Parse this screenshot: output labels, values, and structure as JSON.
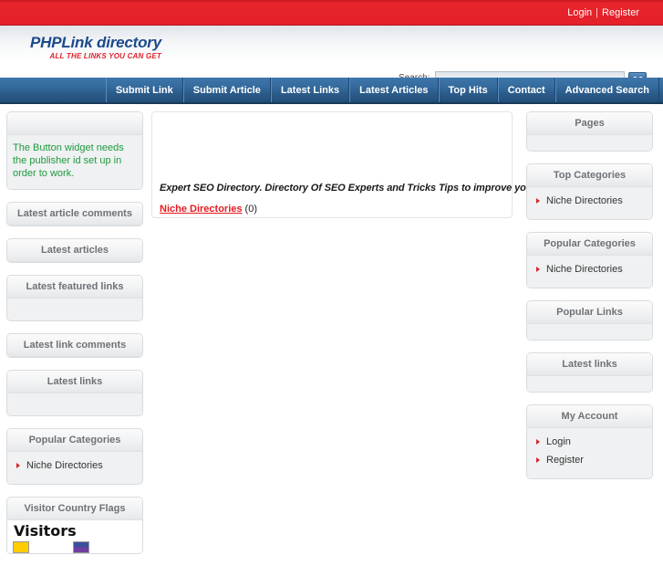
{
  "topbar": {
    "login": "Login",
    "separator": "|",
    "register": "Register"
  },
  "header": {
    "logo_text": "PHPLink directory",
    "logo_tagline": "ALL THE LINKS YOU CAN GET",
    "search_label": "Search:",
    "search_value": "",
    "search_placeholder": "",
    "go_label": "GO"
  },
  "nav": {
    "items": [
      {
        "label": "Submit Link"
      },
      {
        "label": "Submit Article"
      },
      {
        "label": "Latest Links"
      },
      {
        "label": "Latest Articles"
      },
      {
        "label": "Top Hits"
      },
      {
        "label": "Contact"
      },
      {
        "label": "Advanced Search"
      }
    ]
  },
  "left_sidebar": {
    "widgets": [
      {
        "title": "",
        "note": "The Button widget needs the publisher id set up in order to work."
      },
      {
        "title": "Latest article comments"
      },
      {
        "title": "Latest articles"
      },
      {
        "title": "Latest featured links"
      },
      {
        "title": "Latest link comments"
      },
      {
        "title": "Latest links"
      },
      {
        "title": "Popular Categories",
        "links": [
          {
            "label": "Niche Directories"
          }
        ]
      },
      {
        "title": "Visitor Country Flags",
        "heading": "Visitors"
      }
    ]
  },
  "main": {
    "tagline": "Expert SEO Directory. Directory Of SEO Experts and Tricks Tips to improve your webiste rankings.",
    "category_link": "Niche Directories",
    "category_count": "(0)"
  },
  "right_sidebar": {
    "widgets": [
      {
        "title": "Pages"
      },
      {
        "title": "Top Categories",
        "links": [
          {
            "label": "Niche Directories"
          }
        ]
      },
      {
        "title": "Popular Categories",
        "links": [
          {
            "label": "Niche Directories"
          }
        ]
      },
      {
        "title": "Popular Links"
      },
      {
        "title": "Latest links"
      },
      {
        "title": "My Account",
        "links": [
          {
            "label": "Login"
          },
          {
            "label": "Register"
          }
        ]
      }
    ]
  },
  "colors": {
    "brand_red": "#e5212a",
    "nav_blue": "#2c5d8c",
    "logo_blue": "#1b4a8c",
    "link_red": "#e8191f",
    "note_green": "#1f9a3f",
    "widget_gray": "#f1f3f4"
  }
}
